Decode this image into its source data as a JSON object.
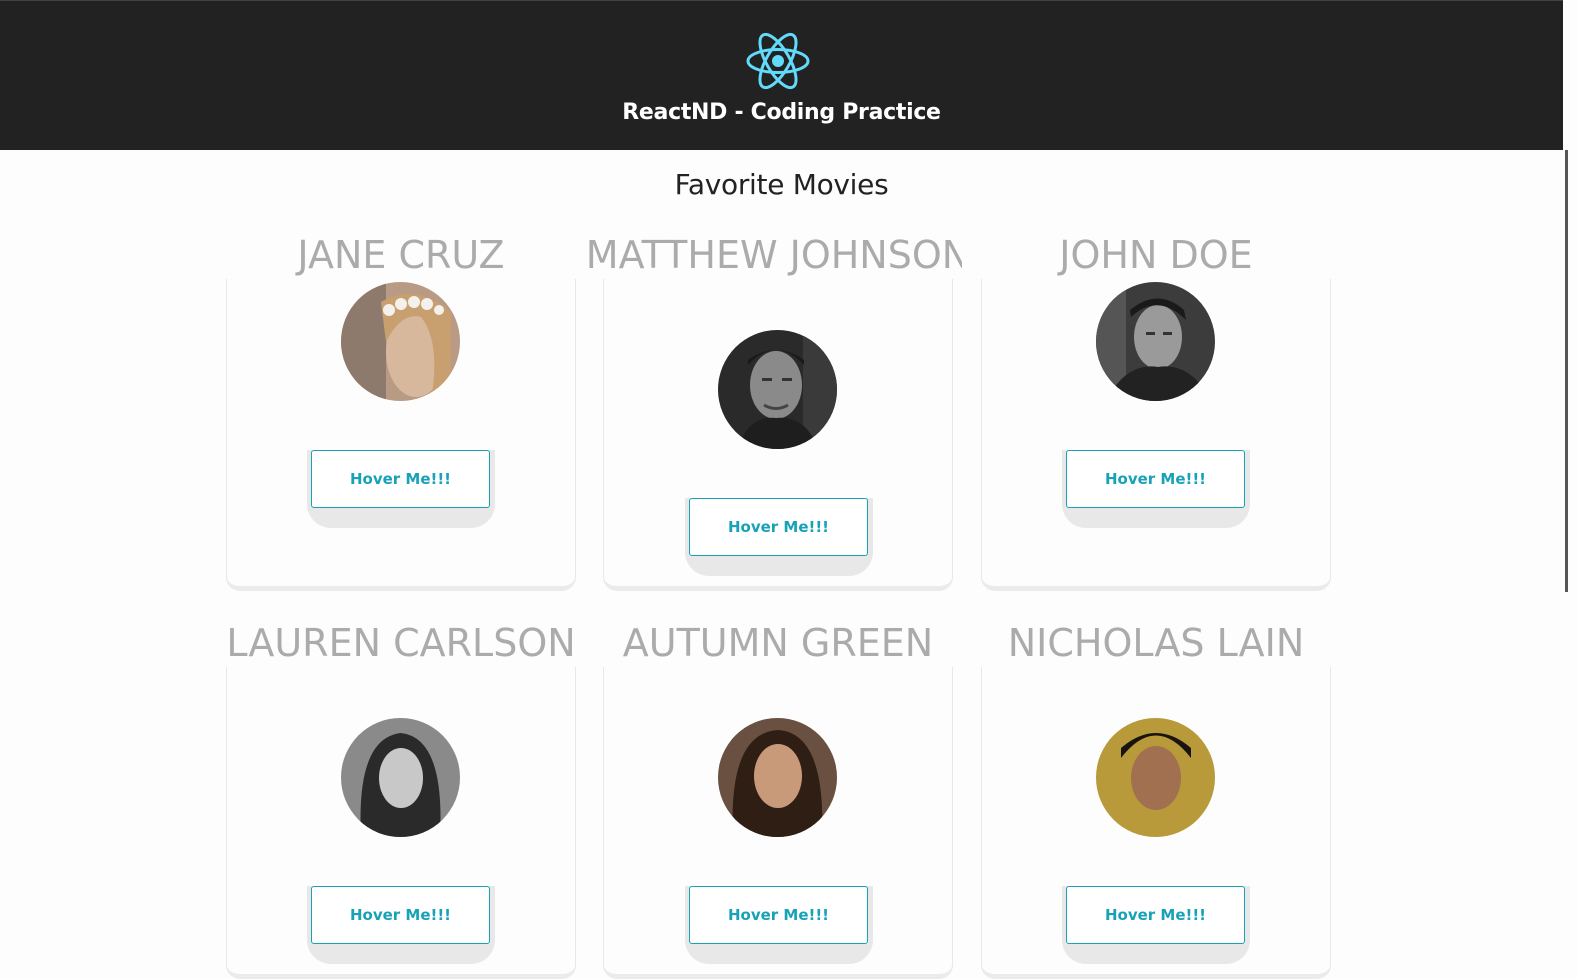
{
  "header": {
    "logo_icon": "react-atom-icon",
    "logo_color": "#61dafb",
    "title": "ReactND - Coding Practice"
  },
  "page": {
    "title": "Favorite Movies"
  },
  "cards": [
    {
      "name": "JANE CRUZ",
      "button_label": "Hover Me!!!"
    },
    {
      "name": "MATTHEW JOHNSON",
      "button_label": "Hover Me!!!"
    },
    {
      "name": "JOHN DOE",
      "button_label": "Hover Me!!!"
    },
    {
      "name": "LAUREN CARLSON",
      "button_label": "Hover Me!!!"
    },
    {
      "name": "AUTUMN GREEN",
      "button_label": "Hover Me!!!"
    },
    {
      "name": "NICHOLAS LAIN",
      "button_label": "Hover Me!!!"
    }
  ],
  "colors": {
    "header_bg": "#222222",
    "accent": "#17a2b8",
    "name_text": "#ababab"
  }
}
